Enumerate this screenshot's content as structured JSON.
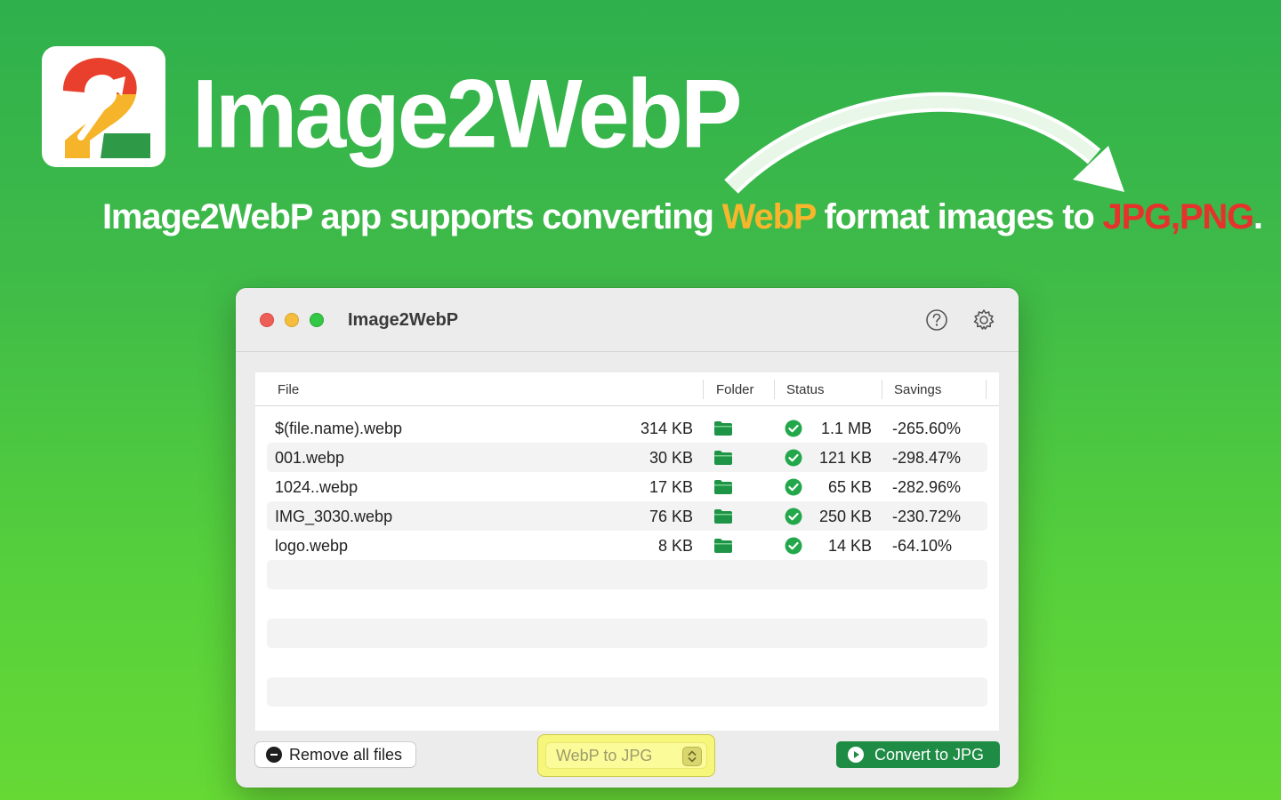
{
  "banner": {
    "brand_title": "Image2WebP",
    "tagline_part1": "Image2WebP app supports converting ",
    "tagline_highlight_webp": "WebP",
    "tagline_part2": " format images to ",
    "tagline_highlight_formats": "JPG,PNG",
    "tagline_end": ".",
    "colors": {
      "background_top": "#2fb04c",
      "background_bottom": "#66d935",
      "highlight_yellow": "#f8b62c",
      "highlight_red": "#e5322d"
    }
  },
  "window": {
    "title": "Image2WebP",
    "toolbar_icons": [
      "help-icon",
      "gear-icon"
    ]
  },
  "table": {
    "columns": [
      "File",
      "Folder",
      "Status",
      "Savings"
    ],
    "rows": [
      {
        "name": "$(file.name).webp",
        "size": "314 KB",
        "status": "check-icon",
        "new_size": "1.1 MB",
        "savings": "-265.60%"
      },
      {
        "name": "001.webp",
        "size": "30 KB",
        "status": "check-icon",
        "new_size": "121 KB",
        "savings": "-298.47%"
      },
      {
        "name": "1024..webp",
        "size": "17 KB",
        "status": "check-icon",
        "new_size": "65 KB",
        "savings": "-282.96%"
      },
      {
        "name": "IMG_3030.webp",
        "size": "76 KB",
        "status": "check-icon",
        "new_size": "250 KB",
        "savings": "-230.72%"
      },
      {
        "name": "logo.webp",
        "size": "8 KB",
        "status": "check-icon",
        "new_size": "14 KB",
        "savings": "-64.10%"
      }
    ]
  },
  "bottom_bar": {
    "remove_label": "Remove all files",
    "format_select_value": "WebP to JPG",
    "convert_label": "Convert to JPG",
    "accent_color": "#1e8c45"
  }
}
